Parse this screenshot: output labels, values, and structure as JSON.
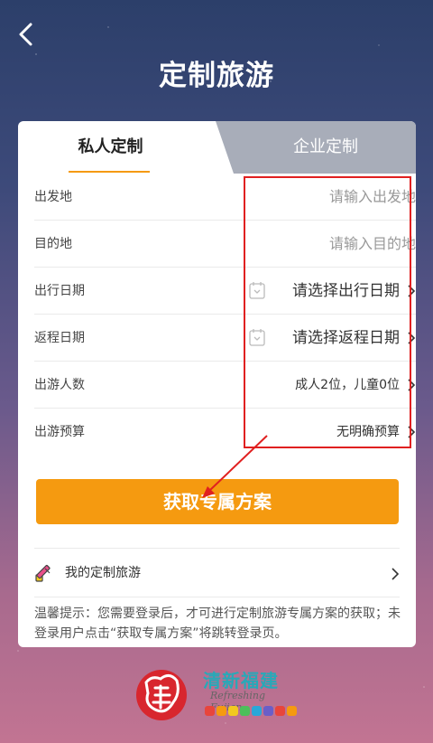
{
  "header": {
    "title": "定制旅游",
    "back_icon": "back-arrow-icon"
  },
  "tabs": [
    {
      "label": "私人定制",
      "active": true
    },
    {
      "label": "企业定制",
      "active": false
    }
  ],
  "form": {
    "rows": [
      {
        "label": "出发地",
        "placeholder": "请输入出发地"
      },
      {
        "label": "目的地",
        "placeholder": "请输入目的地"
      },
      {
        "label": "出行日期",
        "value": "请选择出行日期",
        "icon": "calendar-icon"
      },
      {
        "label": "返程日期",
        "value": "请选择返程日期",
        "icon": "calendar-icon"
      },
      {
        "label": "出游人数",
        "value": "成人2位，儿童0位"
      },
      {
        "label": "出游预算",
        "value": "无明确预算"
      }
    ]
  },
  "primary_button": "获取专属方案",
  "my_trip": {
    "label": "我的定制旅游",
    "icon": "pen-icon"
  },
  "tip": "温馨提示：您需要登录后，才可进行定制旅游专属方案的获取；未登录用户点击“获取专属方案”将跳转登录页。",
  "footer": {
    "logo_char": "福",
    "brand_title": "清新福建",
    "brand_subtitle": "Refreshing Fujian",
    "brand_dot_colors": [
      "#e8453c",
      "#f59a10",
      "#f2c91f",
      "#4cbf5a",
      "#2aa7d8",
      "#6a5ec8",
      "#e8453c",
      "#f59a10"
    ]
  },
  "colors": {
    "accent": "#f59a10",
    "annotation": "#e02020",
    "tab_inactive": "#a8adb9"
  }
}
